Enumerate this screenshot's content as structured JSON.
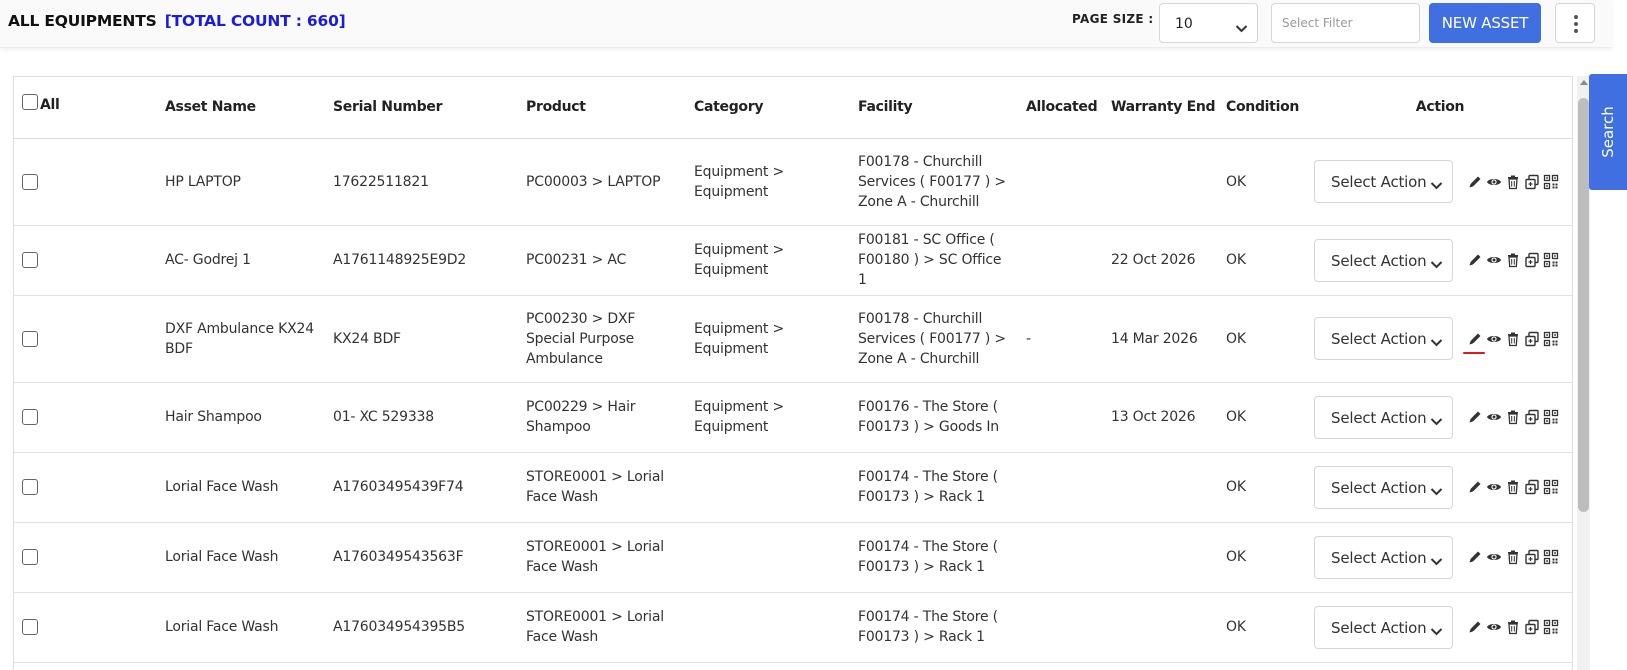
{
  "header": {
    "title": "ALL EQUIPMENTS",
    "total_count": "[TOTAL COUNT : 660]",
    "page_size_label": "PAGE SIZE :",
    "page_size_value": "10",
    "filter_placeholder": "Select Filter",
    "new_asset_label": "NEW ASSET",
    "accent_color": "#3f6fe0"
  },
  "table": {
    "columns": {
      "all": "All",
      "asset_name": "Asset Name",
      "serial_number": "Serial Number",
      "product": "Product",
      "category": "Category",
      "facility": "Facility",
      "allocated": "Allocated",
      "warranty_end": "Warranty End",
      "condition": "Condition",
      "action": "Action"
    },
    "action_select_label": "Select Action",
    "row_icons": [
      "pencil-edit-icon",
      "eye-view-icon",
      "trash-delete-icon",
      "copy-icon",
      "qr-code-icon"
    ],
    "rows": [
      {
        "asset_name": "HP LAPTOP",
        "serial_number": "17622511821",
        "product": "PC00003 > LAPTOP",
        "category": "Equipment > Equipment",
        "facility": "F00178 - Churchill Services ( F00177 ) > Zone A - Churchill",
        "allocated": "",
        "warranty_end": "",
        "condition": "OK"
      },
      {
        "asset_name": "AC- Godrej 1",
        "serial_number": "A1761148925E9D2",
        "product": "PC00231 > AC",
        "category": "Equipment > Equipment",
        "facility": "F00181 - SC Office ( F00180 ) > SC Office 1",
        "allocated": "",
        "warranty_end": "22 Oct 2026",
        "condition": "OK"
      },
      {
        "asset_name": "DXF Ambulance KX24 BDF",
        "serial_number": "KX24 BDF",
        "product": "PC00230 > DXF Special Purpose Ambulance",
        "category": "Equipment > Equipment",
        "facility": "F00178 - Churchill Services ( F00177 ) > Zone A - Churchill",
        "allocated": "-",
        "warranty_end": "14 Mar 2026",
        "condition": "OK"
      },
      {
        "asset_name": "Hair Shampoo",
        "serial_number": "01- XC 529338",
        "product": "PC00229 > Hair Shampoo",
        "category": "Equipment > Equipment",
        "facility": "F00176 - The Store ( F00173 ) > Goods In",
        "allocated": "",
        "warranty_end": "13 Oct 2026",
        "condition": "OK"
      },
      {
        "asset_name": "Lorial Face Wash",
        "serial_number": "A17603495439F74",
        "product": "STORE0001 > Lorial Face Wash",
        "category": "",
        "facility": "F00174 - The Store ( F00173 ) > Rack 1",
        "allocated": "",
        "warranty_end": "",
        "condition": "OK"
      },
      {
        "asset_name": "Lorial Face Wash",
        "serial_number": "A1760349543563F",
        "product": "STORE0001 > Lorial Face Wash",
        "category": "",
        "facility": "F00174 - The Store ( F00173 ) > Rack 1",
        "allocated": "",
        "warranty_end": "",
        "condition": "OK"
      },
      {
        "asset_name": "Lorial Face Wash",
        "serial_number": "A176034954395B5",
        "product": "STORE0001 > Lorial Face Wash",
        "category": "",
        "facility": "F00174 - The Store ( F00173 ) > Rack 1",
        "allocated": "",
        "warranty_end": "",
        "condition": "OK"
      }
    ]
  },
  "side_tab": {
    "label": "Search"
  }
}
